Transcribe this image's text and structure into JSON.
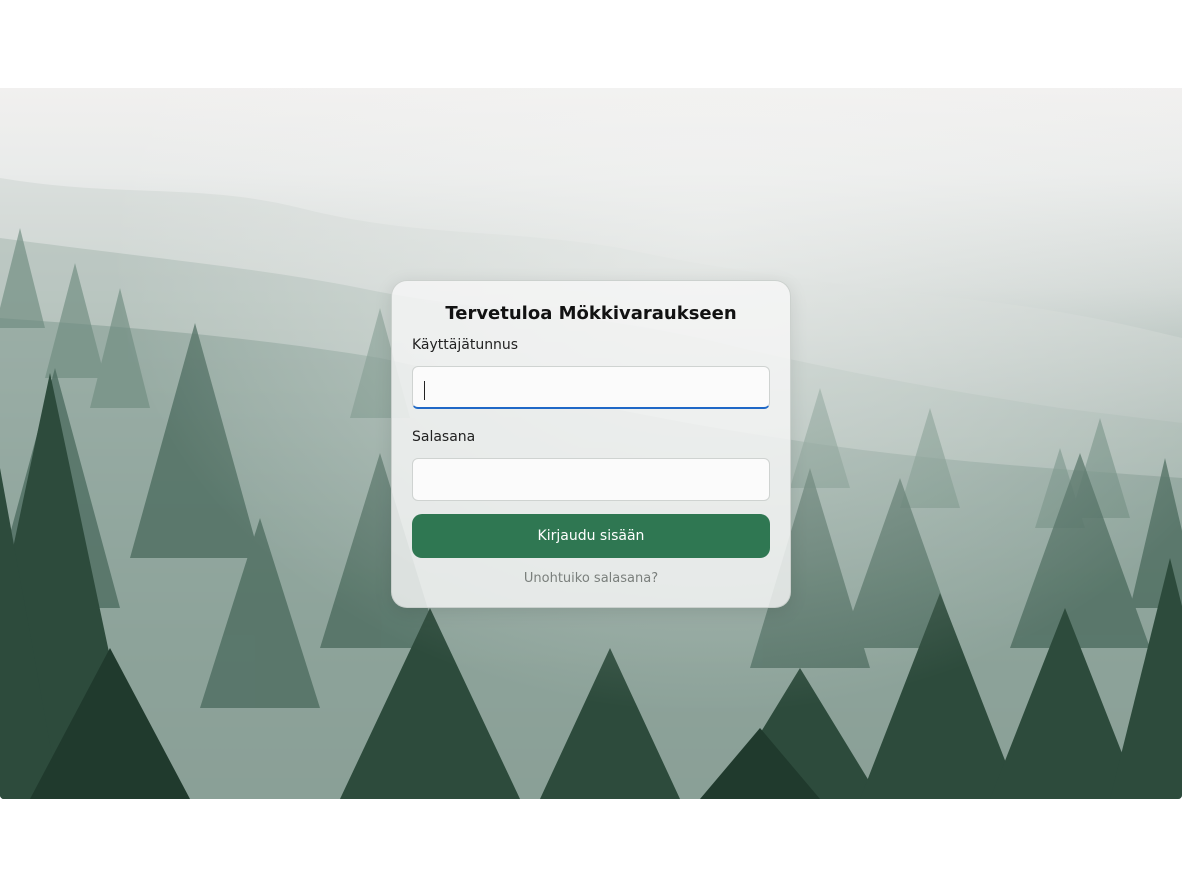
{
  "login": {
    "title": "Tervetuloa Mökkivaraukseen",
    "username_label": "Käyttäjätunnus",
    "username_value": "",
    "password_label": "Salasana",
    "password_value": "",
    "submit_label": "Kirjaudu sisään",
    "forgot_link": "Unohtuiko salasana?"
  },
  "colors": {
    "accent_button": "#2f7752",
    "focus_underline": "#1f68c7"
  }
}
